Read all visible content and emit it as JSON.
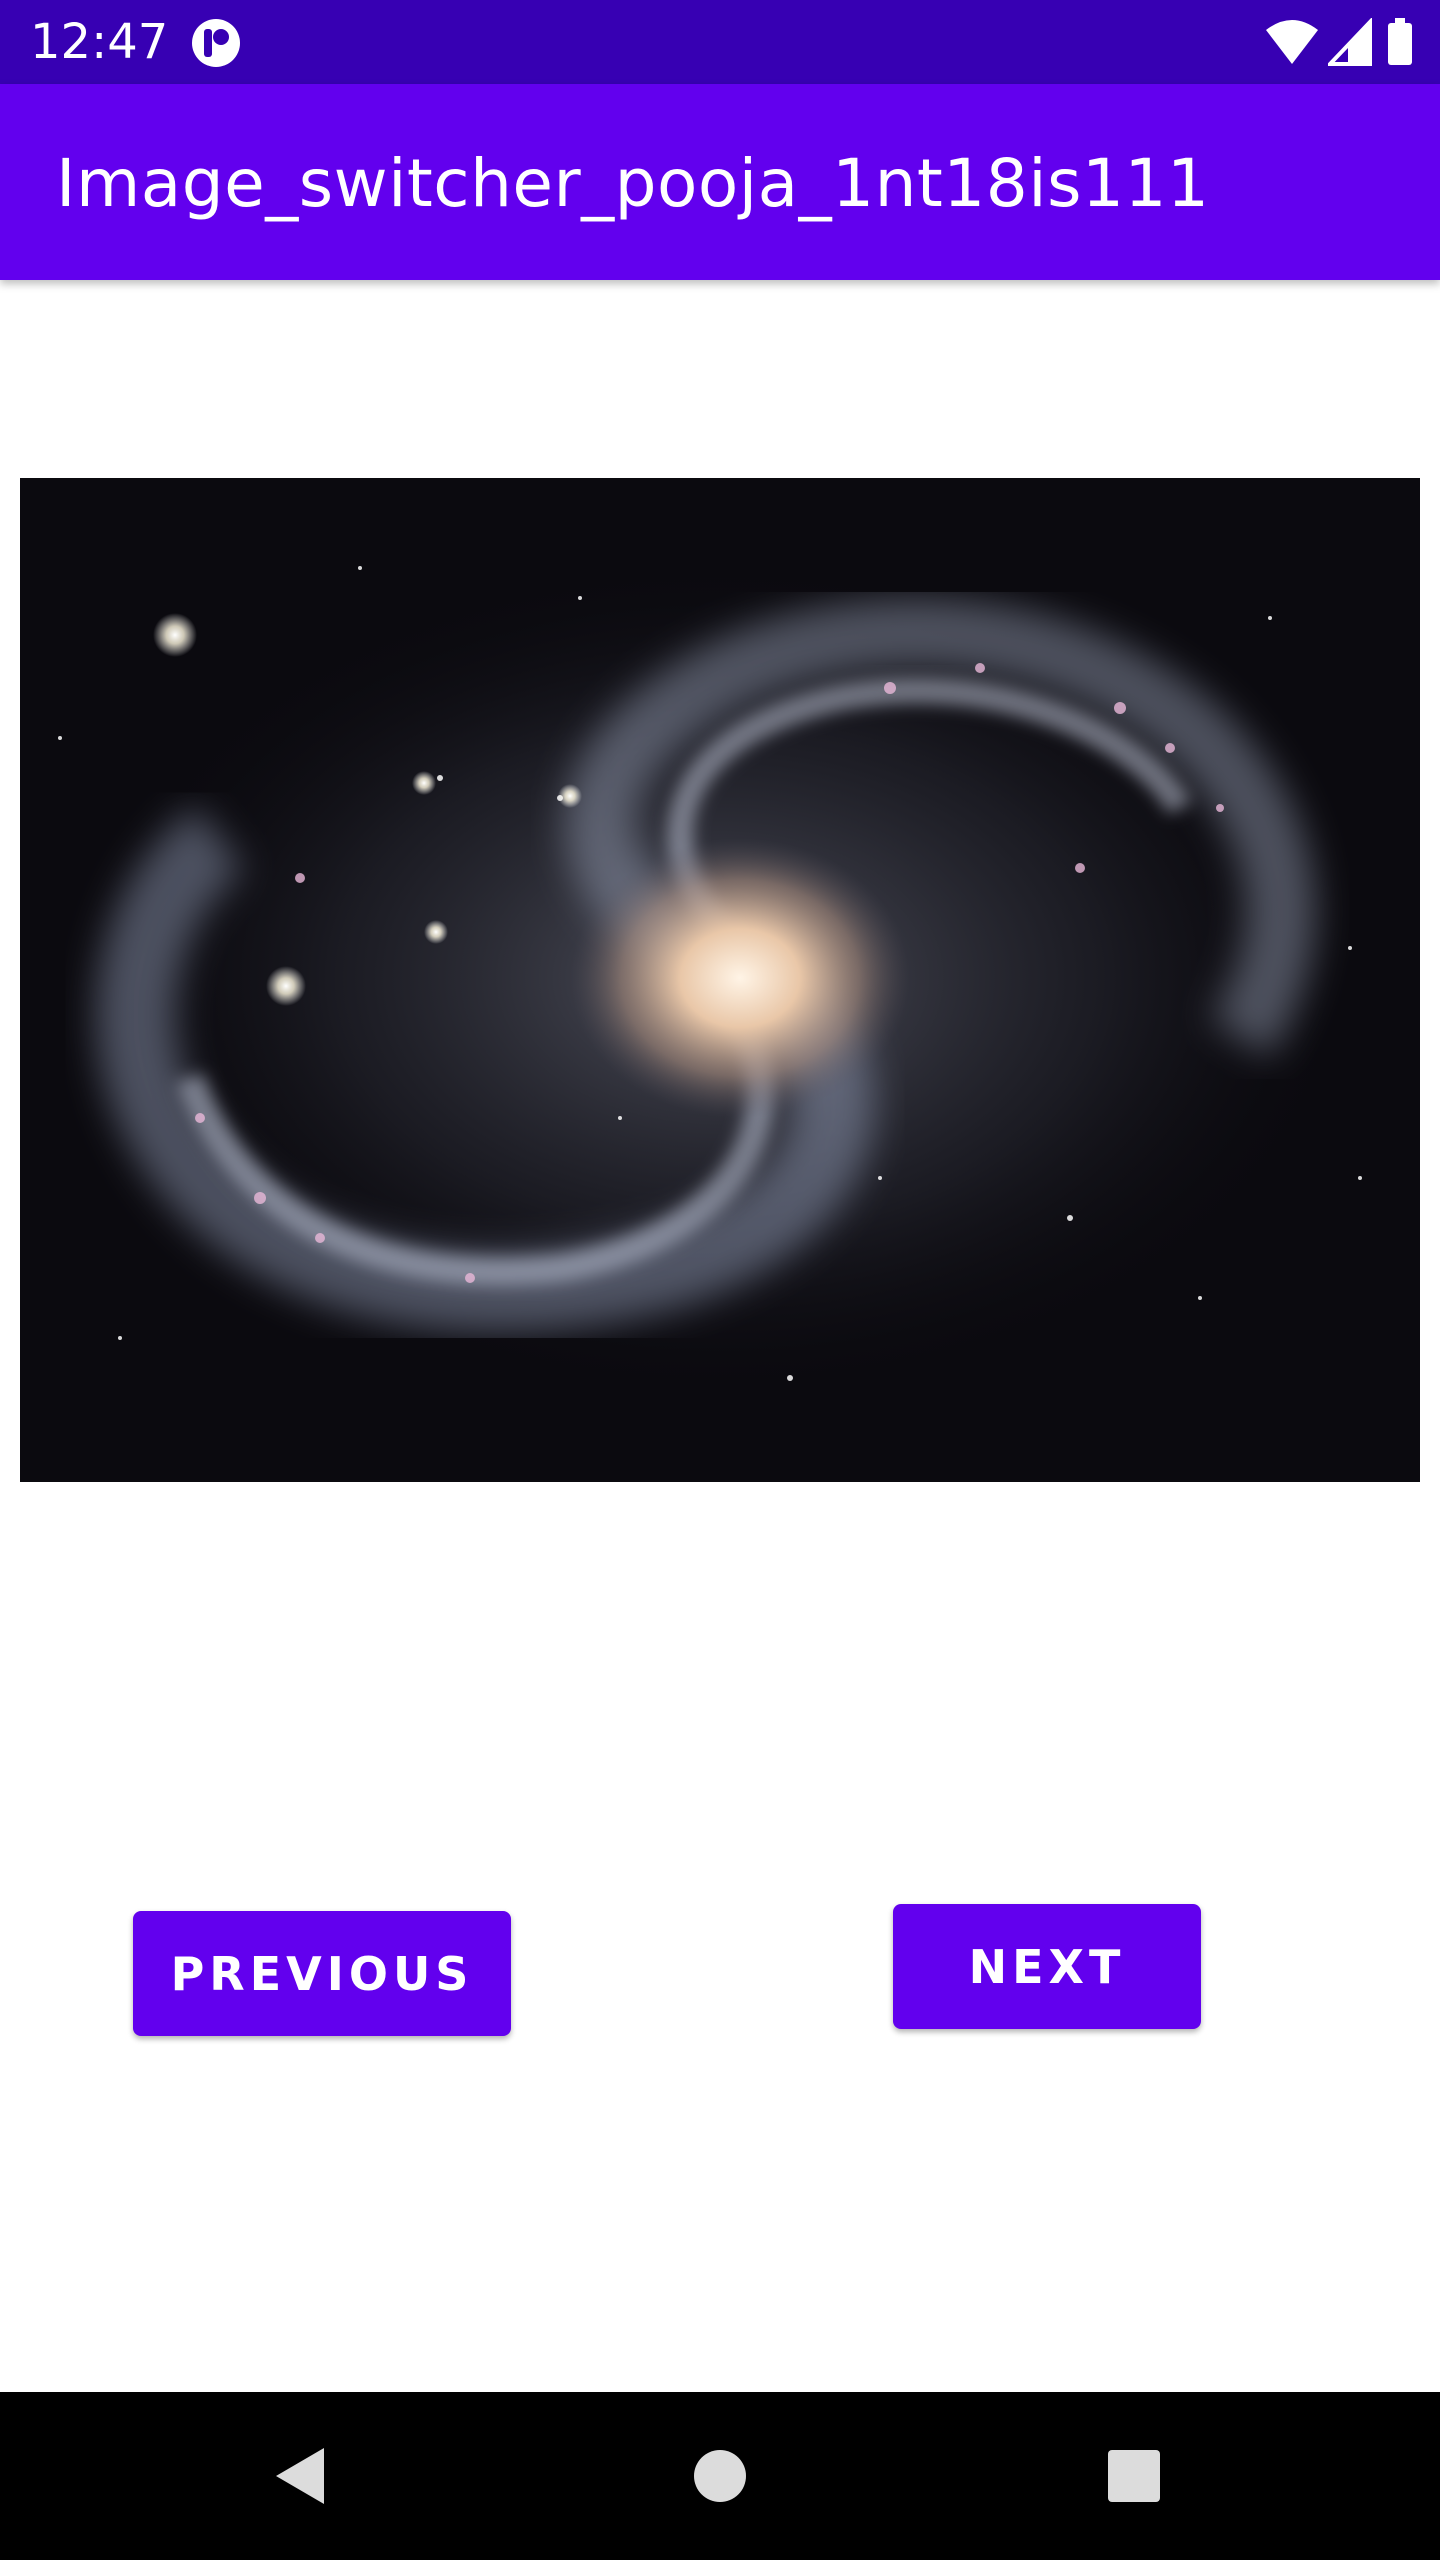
{
  "status_bar": {
    "time": "12:47",
    "icons": [
      "notification-app-icon",
      "wifi-icon",
      "cell-signal-icon",
      "battery-icon"
    ],
    "background": "#3700b3"
  },
  "app_bar": {
    "title": "Image_switcher_pooja_1nt18is111",
    "background": "#6200ee"
  },
  "image_switcher": {
    "content": "spiral-galaxy-image"
  },
  "buttons": {
    "previous_label": "PREVIOUS",
    "next_label": "NEXT",
    "color": "#6200ee"
  },
  "nav_bar": {
    "icons": [
      "back-icon",
      "home-icon",
      "recents-icon"
    ]
  }
}
